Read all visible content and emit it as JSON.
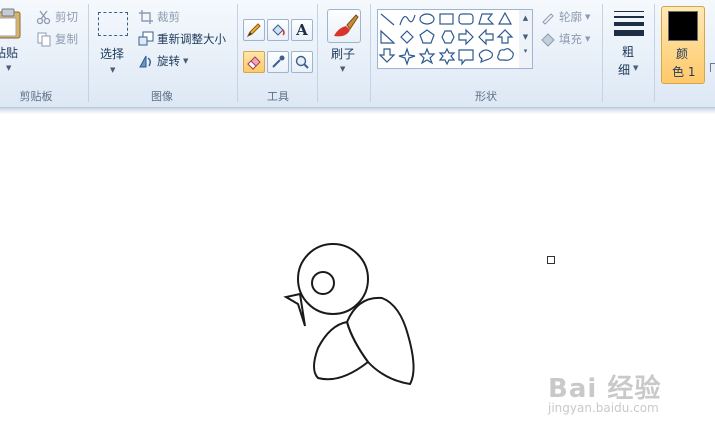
{
  "clipboard": {
    "paste_label": "粘贴",
    "cut_label": "剪切",
    "copy_label": "复制",
    "group_label": "剪贴板"
  },
  "image": {
    "select_label": "选择",
    "crop_label": "裁剪",
    "resize_label": "重新调整大小",
    "rotate_label": "旋转",
    "group_label": "图像"
  },
  "tools": {
    "group_label": "工具",
    "items": [
      "pencil-icon",
      "fill-bucket-icon",
      "text-icon",
      "eraser-icon",
      "color-picker-icon",
      "magnifier-icon"
    ],
    "active": "eraser-icon"
  },
  "brushes": {
    "label": "刷子"
  },
  "shapes": {
    "group_label": "形状",
    "outline_label": "轮廓",
    "fill_label": "填充"
  },
  "size": {
    "label_line1": "粗",
    "label_line2": "细"
  },
  "color1": {
    "label_line1": "颜",
    "label_line2": "色 1",
    "value": "#000000"
  },
  "watermark": {
    "brand": "Bai 经验",
    "url": "jingyan.baidu.com"
  },
  "colors": {
    "ribbon_top": "#f5f9fd",
    "ribbon_bottom": "#dde8f5",
    "active_highlight": "#ffc96a"
  }
}
